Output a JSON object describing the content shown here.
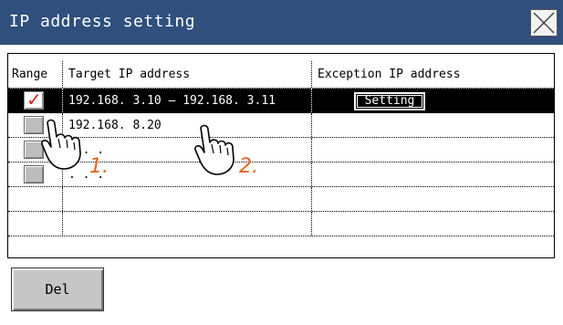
{
  "window": {
    "title": "IP address setting",
    "close_icon": "close-x-icon"
  },
  "table": {
    "headers": {
      "range": "Range",
      "target": "Target IP address",
      "exception": "Exception IP address"
    },
    "rows": [
      {
        "range_checked": true,
        "target": "192.168.  3.10 – 192.168.  3.11",
        "exception_button": "Setting",
        "selected": true
      },
      {
        "range_checked": false,
        "target": "192.168.  8.20",
        "exception_button": "",
        "selected": false
      },
      {
        "range_checked": false,
        "target": "   .   .   .",
        "exception_button": "",
        "selected": false
      },
      {
        "range_checked": false,
        "target": "   .   .   .",
        "exception_button": "",
        "selected": false
      },
      {
        "range_checked": null,
        "target": "",
        "exception_button": "",
        "selected": false
      },
      {
        "range_checked": null,
        "target": "",
        "exception_button": "",
        "selected": false
      }
    ]
  },
  "buttons": {
    "delete": "Del"
  },
  "annotations": {
    "step1": "1.",
    "step2": "2.",
    "hand_icon": "pointing-hand-icon",
    "color": "#e8641e"
  },
  "colors": {
    "titlebar": "#2f4f7d",
    "checkmark": "#e01818",
    "selected_row": "#000000"
  }
}
